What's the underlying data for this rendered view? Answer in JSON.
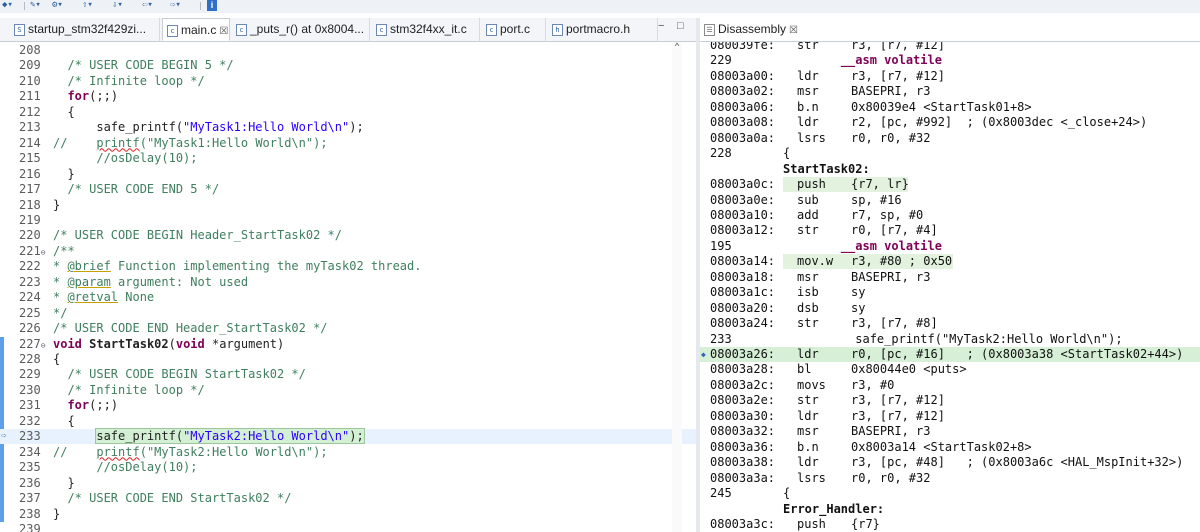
{
  "toolbar": {
    "icons": [
      "toolbar-icon",
      "bookmark-icon",
      "build-icon",
      "up-arrow-icon",
      "back-icon",
      "forward-icon",
      "info-icon"
    ],
    "info_label": "i"
  },
  "editor_tabs": [
    {
      "label": "startup_stm32f429zi...",
      "icon": "S",
      "active": false
    },
    {
      "label": "main.c",
      "icon": "c",
      "active": true,
      "close": "☒"
    },
    {
      "label": "_puts_r() at 0x8004...",
      "icon": "c",
      "active": false
    },
    {
      "label": "stm32f4xx_it.c",
      "icon": "c",
      "active": false
    },
    {
      "label": "port.c",
      "icon": "c",
      "active": false
    },
    {
      "label": "portmacro.h",
      "icon": "h",
      "active": false
    }
  ],
  "editor_window_controls": [
    "−",
    "□"
  ],
  "disasm_tab": {
    "label": "Disassembly",
    "close": "☒"
  },
  "colors": {
    "accent": "#5d9fe8",
    "current_line": "#e8f2fe",
    "comment": "#3f7f5f",
    "keyword": "#7f0055",
    "string": "#2a00ff"
  },
  "code_lines": [
    {
      "n": "208",
      "t": ""
    },
    {
      "n": "209",
      "t": "  /* USER CODE BEGIN 5 */"
    },
    {
      "n": "210",
      "t": "  /* Infinite loop */"
    },
    {
      "n": "211",
      "t": "  for(;;)"
    },
    {
      "n": "212",
      "t": "  {"
    },
    {
      "n": "213",
      "t": "      safe_printf(\"MyTask1:Hello World\\n\");"
    },
    {
      "n": "214",
      "t": "//    printf(\"MyTask1:Hello World\\n\");"
    },
    {
      "n": "215",
      "t": "      //osDelay(10);"
    },
    {
      "n": "216",
      "t": "  }"
    },
    {
      "n": "217",
      "t": "  /* USER CODE END 5 */"
    },
    {
      "n": "218",
      "t": "}"
    },
    {
      "n": "219",
      "t": ""
    },
    {
      "n": "220",
      "t": "/* USER CODE BEGIN Header_StartTask02 */"
    },
    {
      "n": "221",
      "t": "/**"
    },
    {
      "n": "222",
      "t": "* @brief Function implementing the myTask02 thread."
    },
    {
      "n": "223",
      "t": "* @param argument: Not used"
    },
    {
      "n": "224",
      "t": "* @retval None"
    },
    {
      "n": "225",
      "t": "*/"
    },
    {
      "n": "226",
      "t": "/* USER CODE END Header_StartTask02 */"
    },
    {
      "n": "227",
      "t": "void StartTask02(void *argument)"
    },
    {
      "n": "228",
      "t": "{"
    },
    {
      "n": "229",
      "t": "  /* USER CODE BEGIN StartTask02 */"
    },
    {
      "n": "230",
      "t": "  /* Infinite loop */"
    },
    {
      "n": "231",
      "t": "  for(;;)"
    },
    {
      "n": "232",
      "t": "  {"
    },
    {
      "n": "233",
      "t": "      safe_printf(\"MyTask2:Hello World\\n\");"
    },
    {
      "n": "234",
      "t": "//    printf(\"MyTask2:Hello World\\n\");"
    },
    {
      "n": "235",
      "t": "      //osDelay(10);"
    },
    {
      "n": "236",
      "t": "  }"
    },
    {
      "n": "237",
      "t": "  /* USER CODE END StartTask02 */"
    },
    {
      "n": "238",
      "t": "}"
    },
    {
      "n": "239",
      "t": ""
    }
  ],
  "disasm_lines": [
    {
      "kind": "ins",
      "addr": "080039fe:",
      "mn": "str",
      "op": "r3, [r7, #12]"
    },
    {
      "kind": "src",
      "num": "229",
      "text": "        __asm volatile"
    },
    {
      "kind": "ins",
      "addr": "08003a00:",
      "mn": "ldr",
      "op": "r3, [r7, #12]"
    },
    {
      "kind": "ins",
      "addr": "08003a02:",
      "mn": "msr",
      "op": "BASEPRI, r3"
    },
    {
      "kind": "ins",
      "addr": "08003a06:",
      "mn": "b.n",
      "op": "0x80039e4 <StartTask01+8>"
    },
    {
      "kind": "ins",
      "addr": "08003a08:",
      "mn": "ldr",
      "op": "r2, [pc, #992]  ; (0x8003dec <_close+24>)"
    },
    {
      "kind": "ins",
      "addr": "08003a0a:",
      "mn": "lsrs",
      "op": "r0, r0, #32"
    },
    {
      "kind": "src",
      "num": "228",
      "text": "{"
    },
    {
      "kind": "label",
      "text": "StartTask02:"
    },
    {
      "kind": "ins",
      "addr": "08003a0c:",
      "mn": "push",
      "op": "{r7, lr}",
      "hl": true
    },
    {
      "kind": "ins",
      "addr": "08003a0e:",
      "mn": "sub",
      "op": "sp, #16"
    },
    {
      "kind": "ins",
      "addr": "08003a10:",
      "mn": "add",
      "op": "r7, sp, #0"
    },
    {
      "kind": "ins",
      "addr": "08003a12:",
      "mn": "str",
      "op": "r0, [r7, #4]"
    },
    {
      "kind": "src",
      "num": "195",
      "text": "        __asm volatile"
    },
    {
      "kind": "ins",
      "addr": "08003a14:",
      "mn": "mov.w",
      "op": "r3, #80 ; 0x50",
      "hl": true
    },
    {
      "kind": "ins",
      "addr": "08003a18:",
      "mn": "msr",
      "op": "BASEPRI, r3"
    },
    {
      "kind": "ins",
      "addr": "08003a1c:",
      "mn": "isb",
      "op": "sy"
    },
    {
      "kind": "ins",
      "addr": "08003a20:",
      "mn": "dsb",
      "op": "sy"
    },
    {
      "kind": "ins",
      "addr": "08003a24:",
      "mn": "str",
      "op": "r3, [r7, #8]"
    },
    {
      "kind": "src",
      "num": "233",
      "text": "          safe_printf(\"MyTask2:Hello World\\n\");"
    },
    {
      "kind": "ins",
      "addr": "08003a26:",
      "mn": "ldr",
      "op": "r0, [pc, #16]   ; (0x8003a38 <StartTask02+44>)",
      "cur": true
    },
    {
      "kind": "ins",
      "addr": "08003a28:",
      "mn": "bl",
      "op": "0x80044e0 <puts>"
    },
    {
      "kind": "ins",
      "addr": "08003a2c:",
      "mn": "movs",
      "op": "r3, #0"
    },
    {
      "kind": "ins",
      "addr": "08003a2e:",
      "mn": "str",
      "op": "r3, [r7, #12]"
    },
    {
      "kind": "ins",
      "addr": "08003a30:",
      "mn": "ldr",
      "op": "r3, [r7, #12]"
    },
    {
      "kind": "ins",
      "addr": "08003a32:",
      "mn": "msr",
      "op": "BASEPRI, r3"
    },
    {
      "kind": "ins",
      "addr": "08003a36:",
      "mn": "b.n",
      "op": "0x8003a14 <StartTask02+8>"
    },
    {
      "kind": "ins",
      "addr": "08003a38:",
      "mn": "ldr",
      "op": "r3, [pc, #48]   ; (0x8003a6c <HAL_MspInit+32>)"
    },
    {
      "kind": "ins",
      "addr": "08003a3a:",
      "mn": "lsrs",
      "op": "r0, r0, #32"
    },
    {
      "kind": "src",
      "num": "245",
      "text": "{"
    },
    {
      "kind": "label",
      "text": "Error_Handler:"
    },
    {
      "kind": "ins",
      "addr": "08003a3c:",
      "mn": "push",
      "op": "{r7}"
    }
  ]
}
